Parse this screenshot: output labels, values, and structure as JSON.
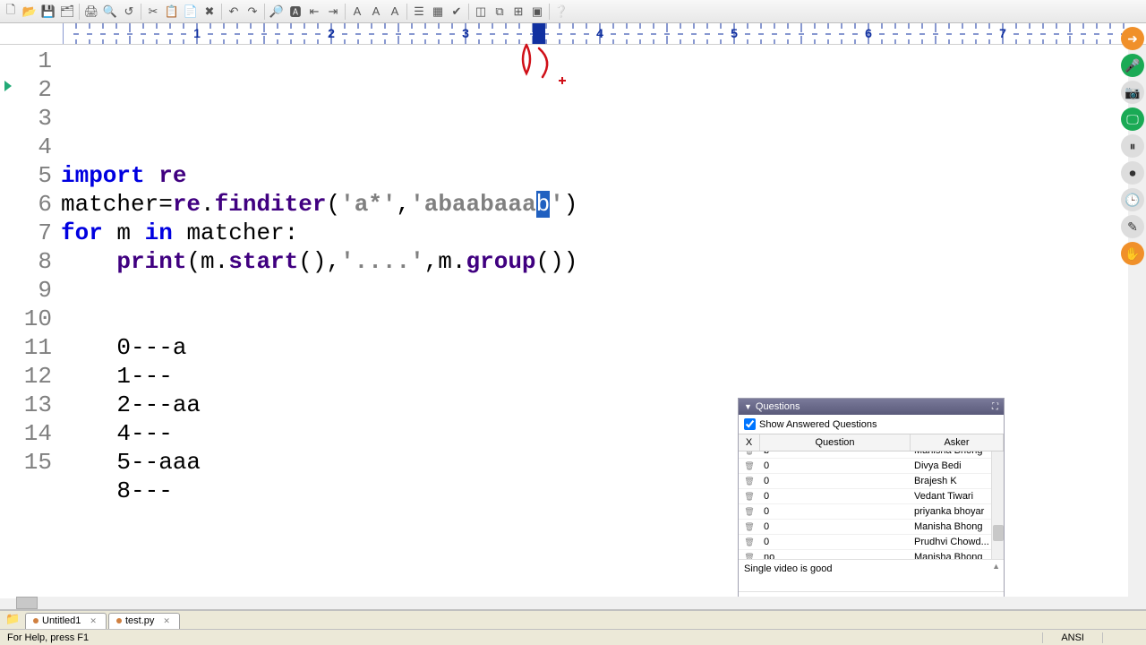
{
  "toolbar_icons": [
    "new",
    "open",
    "save",
    "saveall",
    "|",
    "print",
    "preview",
    "undo2",
    "|",
    "cut",
    "copy",
    "paste",
    "del",
    "|",
    "undo",
    "redo",
    "|",
    "zoomin",
    "find",
    "indent-l",
    "indent-r",
    "|",
    "h1",
    "h2",
    "h3",
    "|",
    "toggle1",
    "toggle2",
    "check",
    "|",
    "win1",
    "win2",
    "win3",
    "win4",
    "|",
    "help"
  ],
  "ruler": {
    "major_labels": [
      "1",
      "2",
      "3",
      "4",
      "5",
      "6",
      "7"
    ],
    "cursor_col": 35
  },
  "code": {
    "lines": [
      {
        "n": 1,
        "seg": [
          [
            "kw",
            "import "
          ],
          [
            "nm",
            "re"
          ]
        ]
      },
      {
        "n": 2,
        "seg": [
          [
            "plain",
            "matcher="
          ],
          [
            "nm",
            "re"
          ],
          [
            "plain",
            "."
          ],
          [
            "nm",
            "finditer"
          ],
          [
            "plain",
            "("
          ],
          [
            "str",
            "'a*'"
          ],
          [
            "plain",
            ","
          ],
          [
            "str",
            "'abaabaaa"
          ],
          [
            "selch",
            "b"
          ],
          [
            "str",
            "'"
          ],
          [
            "plain",
            ")"
          ]
        ]
      },
      {
        "n": 3,
        "seg": [
          [
            "kw",
            "for "
          ],
          [
            "plain",
            "m "
          ],
          [
            "kw",
            "in "
          ],
          [
            "plain",
            "matcher:"
          ]
        ]
      },
      {
        "n": 4,
        "seg": [
          [
            "plain",
            "    "
          ],
          [
            "nm",
            "print"
          ],
          [
            "plain",
            "(m."
          ],
          [
            "nm",
            "start"
          ],
          [
            "plain",
            "(),"
          ],
          [
            "str",
            "'....'"
          ],
          [
            "plain",
            ",m."
          ],
          [
            "nm",
            "group"
          ],
          [
            "plain",
            "())"
          ]
        ]
      },
      {
        "n": 5,
        "seg": []
      },
      {
        "n": 6,
        "seg": []
      },
      {
        "n": 7,
        "seg": [
          [
            "plain",
            "    0---a"
          ]
        ]
      },
      {
        "n": 8,
        "seg": [
          [
            "plain",
            "    1---"
          ]
        ]
      },
      {
        "n": 9,
        "seg": [
          [
            "plain",
            "    2---aa"
          ]
        ]
      },
      {
        "n": 10,
        "seg": [
          [
            "plain",
            "    4---"
          ]
        ]
      },
      {
        "n": 11,
        "seg": [
          [
            "plain",
            "    5--aaa"
          ]
        ]
      },
      {
        "n": 12,
        "seg": [
          [
            "plain",
            "    8---"
          ]
        ]
      },
      {
        "n": 13,
        "seg": []
      },
      {
        "n": 14,
        "seg": []
      },
      {
        "n": 15,
        "seg": []
      }
    ]
  },
  "questions": {
    "title": "Questions",
    "show_answered_label": "Show Answered Questions",
    "columns": {
      "x": "X",
      "q": "Question",
      "a": "Asker"
    },
    "rows": [
      {
        "q": "b",
        "a": "Manisha Bhong"
      },
      {
        "q": "0",
        "a": "Divya Bedi"
      },
      {
        "q": "0",
        "a": "Brajesh K"
      },
      {
        "q": "0",
        "a": "Vedant Tiwari"
      },
      {
        "q": "0",
        "a": "priyanka bhoyar"
      },
      {
        "q": "0",
        "a": "Manisha Bhong"
      },
      {
        "q": "0",
        "a": "Prudhvi Chowd..."
      },
      {
        "q": "no",
        "a": "Manisha Bhong"
      }
    ],
    "footer_text": "Single video is good"
  },
  "tabs": [
    {
      "label": "Untitled1",
      "dirty": true
    },
    {
      "label": "test.py",
      "dirty": true
    }
  ],
  "status": {
    "help": "For Help, press F1",
    "encoding": "ANSI"
  },
  "dock_icons": [
    "back",
    "mic",
    "cam",
    "screen",
    "pause",
    "rec",
    "clock",
    "pen",
    "hand"
  ]
}
